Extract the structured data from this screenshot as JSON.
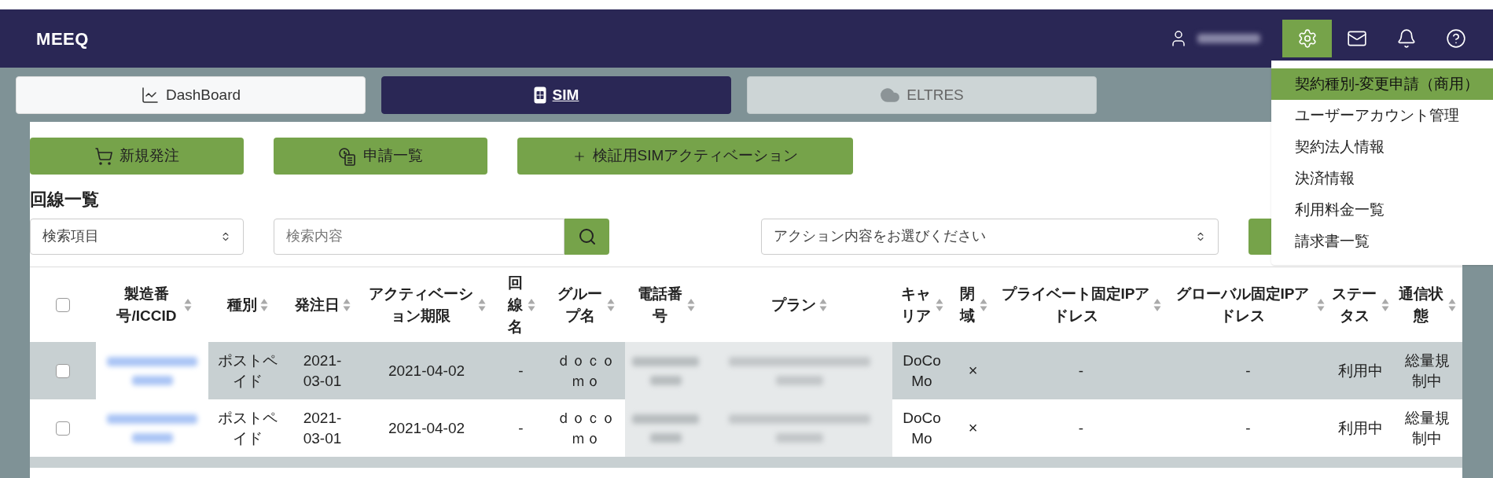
{
  "header": {
    "brand": "MEEQ"
  },
  "nav_tabs": [
    {
      "label": "DashBoard",
      "selected": false,
      "disabled": false,
      "kind": "chart"
    },
    {
      "label": "SIM",
      "selected": true,
      "disabled": false,
      "kind": "sim"
    },
    {
      "label": "ELTRES",
      "selected": false,
      "disabled": true,
      "kind": "cloud"
    }
  ],
  "settings_menu": {
    "open": true,
    "items": [
      {
        "label": "契約種別-変更申請（商用）",
        "selected": true
      },
      {
        "label": "ユーザーアカウント管理",
        "selected": false
      },
      {
        "label": "契約法人情報",
        "selected": false
      },
      {
        "label": "決済情報",
        "selected": false
      },
      {
        "label": "利用料金一覧",
        "selected": false
      },
      {
        "label": "請求書一覧",
        "selected": false
      }
    ]
  },
  "actions": [
    {
      "label": "新規発注",
      "kind": "cart"
    },
    {
      "label": "申請一覧",
      "kind": "clock-doc"
    },
    {
      "label": "検証用SIMアクティベーション",
      "kind": "plus"
    }
  ],
  "section_title": "回線一覧",
  "search": {
    "field_select": "検索項目",
    "placeholder": "検索内容",
    "action_select": "アクション内容をお選びください"
  },
  "table": {
    "select_all_checked": false,
    "columns": [
      "製造番号/ICCID",
      "種別",
      "発注日",
      "アクティベーション期限",
      "回線名",
      "グループ名",
      "電話番号",
      "プラン",
      "キャリア",
      "閉域",
      "プライベート固定IPアドレス",
      "グローバル固定IPアドレス",
      "ステータス",
      "通信状態"
    ],
    "rows": [
      {
        "checked": false,
        "type": "ポストペイド",
        "order_date": "2021-03-01",
        "activation_deadline": "2021-04-02",
        "line_name": "-",
        "group": "ｄｏｃｏｍｏ",
        "carrier": "DoCoMo",
        "closed_network": "×",
        "private_ip": "-",
        "global_ip": "-",
        "status": "利用中",
        "connection": "総量規制中"
      },
      {
        "checked": false,
        "type": "ポストペイド",
        "order_date": "2021-03-01",
        "activation_deadline": "2021-04-02",
        "line_name": "-",
        "group": "ｄｏｃｏｍｏ",
        "carrier": "DoCoMo",
        "closed_network": "×",
        "private_ip": "-",
        "global_ip": "-",
        "status": "利用中",
        "connection": "総量規制中"
      }
    ]
  }
}
